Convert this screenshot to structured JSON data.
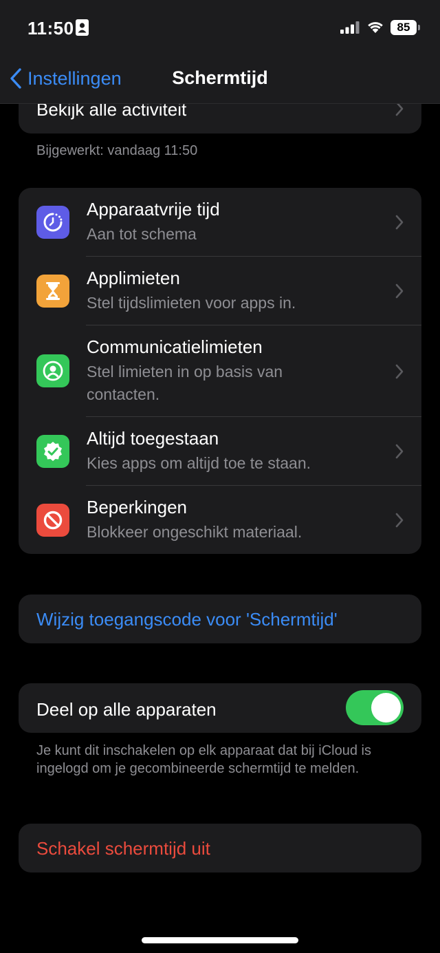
{
  "status_bar": {
    "time": "11:50",
    "battery": "85"
  },
  "nav": {
    "back_label": "Instellingen",
    "title": "Schermtijd"
  },
  "activity": {
    "label": "Bekijk alle activiteit",
    "updated": "Bijgewerkt: vandaag 11:50"
  },
  "items": [
    {
      "title": "Apparaatvrije tijd",
      "subtitle": "Aan tot schema",
      "icon": "downtime-icon",
      "color": "#5e5ce6"
    },
    {
      "title": "Applimieten",
      "subtitle": "Stel tijdslimieten voor apps in.",
      "icon": "hourglass-icon",
      "color": "#f2a33a"
    },
    {
      "title": "Communicatielimieten",
      "subtitle": "Stel limieten in op basis van contacten.",
      "icon": "person-circle-icon",
      "color": "#34c759"
    },
    {
      "title": "Altijd toegestaan",
      "subtitle": "Kies apps om altijd toe te staan.",
      "icon": "checkmark-seal-icon",
      "color": "#34c759"
    },
    {
      "title": "Beperkingen",
      "subtitle": "Blokkeer ongeschikt materiaal.",
      "icon": "restriction-icon",
      "color": "#eb4b3d"
    }
  ],
  "passcode": {
    "label": "Wijzig toegangscode voor 'Schermtijd'",
    "color": "#3b8cf6"
  },
  "share": {
    "label": "Deel op alle apparaten",
    "enabled": true,
    "footnote": "Je kunt dit inschakelen op elk apparaat dat bij iCloud is ingelogd om je gecombineerde schermtijd te melden."
  },
  "disable": {
    "label": "Schakel schermtijd uit",
    "color": "#eb4b3d"
  }
}
